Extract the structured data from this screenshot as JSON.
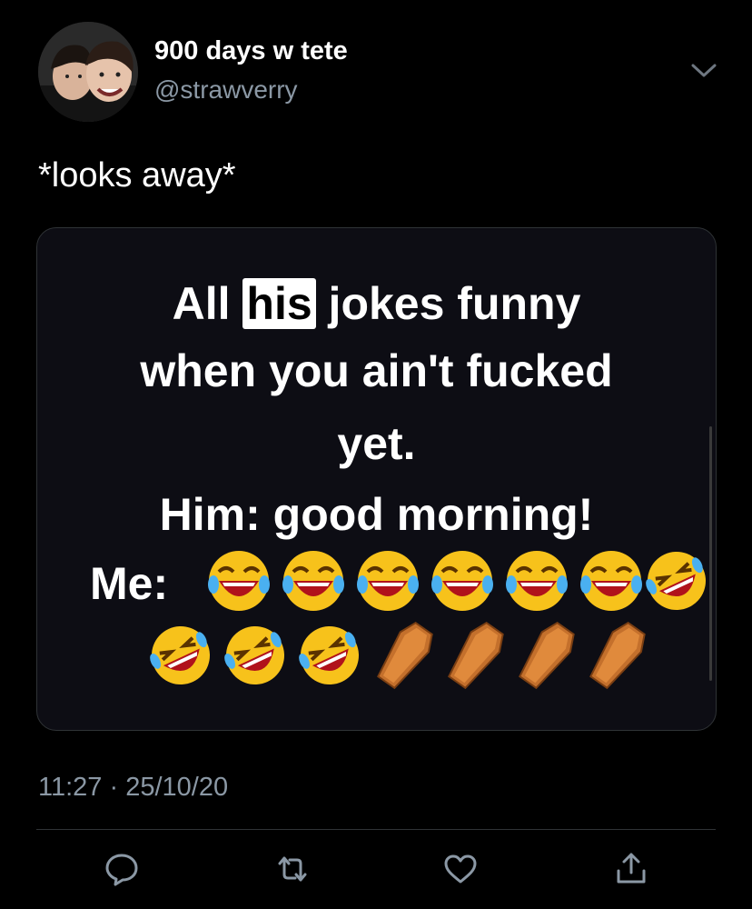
{
  "user": {
    "display_name": "900 days w tete",
    "handle": "@strawverry"
  },
  "tweet": {
    "text": "*looks away*",
    "timestamp": "11:27 · 25/10/20"
  },
  "media": {
    "line1_prefix": "All ",
    "line1_highlight": "his",
    "line1_suffix": " jokes funny",
    "line2": "when you ain't fucked",
    "line3": "yet.",
    "line4_label": "Him",
    "line4_text": ": good morning!",
    "line5_label": "Me:"
  },
  "icons": {
    "reply": "reply-icon",
    "retweet": "retweet-icon",
    "like": "like-icon",
    "share": "share-icon",
    "more": "chevron-down-icon"
  },
  "colors": {
    "background": "#000000",
    "secondary_text": "#8b98a5",
    "border": "#2f3336"
  }
}
